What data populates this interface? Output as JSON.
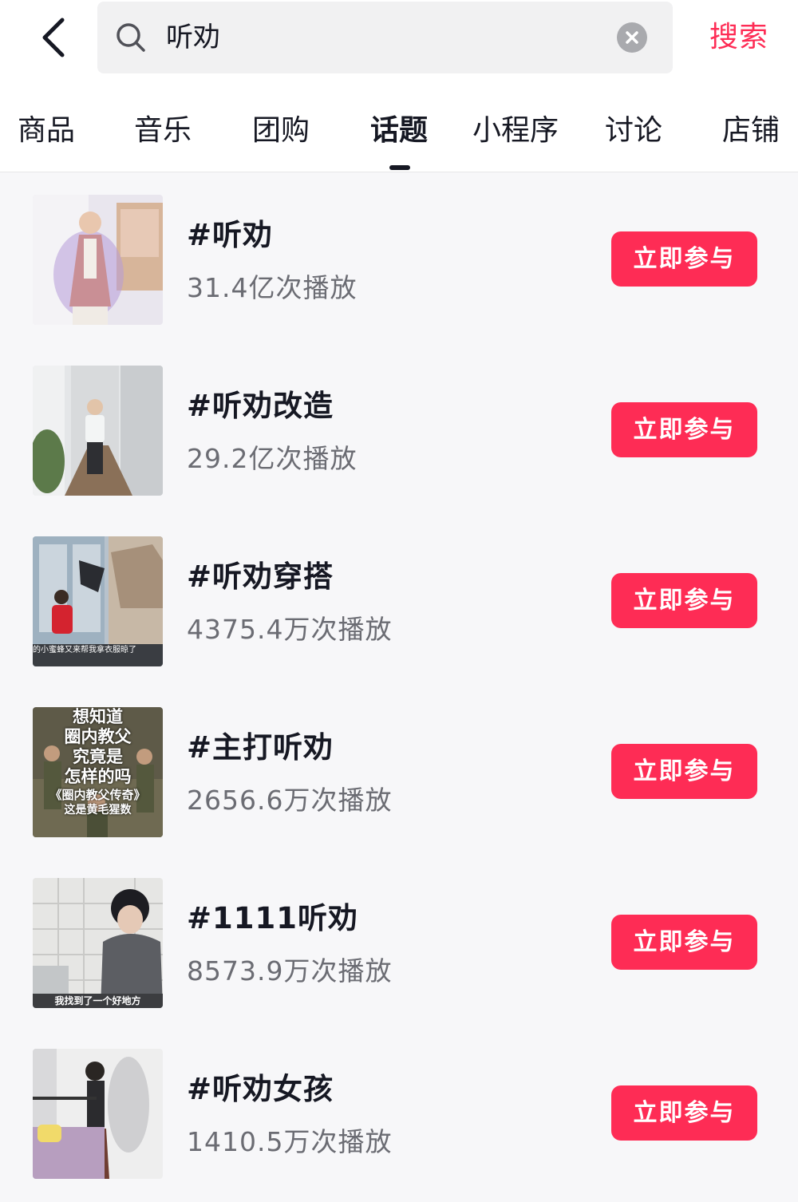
{
  "header": {
    "back_icon": "chevron-left-icon",
    "search": {
      "icon": "search-icon",
      "value": "听劝",
      "placeholder": "",
      "clear_icon": "close-circle-icon"
    },
    "search_button_label": "搜索"
  },
  "tabs": [
    {
      "label": "商品",
      "active": false
    },
    {
      "label": "音乐",
      "active": false
    },
    {
      "label": "团购",
      "active": false
    },
    {
      "label": "话题",
      "active": true
    },
    {
      "label": "小程序",
      "active": false
    },
    {
      "label": "讨论",
      "active": false
    },
    {
      "label": "店铺",
      "active": false
    }
  ],
  "topics": [
    {
      "title": "#听劝",
      "plays": "31.4亿次播放",
      "button": "立即参与",
      "thumb_caption": ""
    },
    {
      "title": "#听劝改造",
      "plays": "29.2亿次播放",
      "button": "立即参与",
      "thumb_caption": ""
    },
    {
      "title": "#听劝穿搭",
      "plays": "4375.4万次播放",
      "button": "立即参与",
      "thumb_caption": "的小蜜蜂又来帮我拿衣服晾了"
    },
    {
      "title": "#主打听劝",
      "plays": "2656.6万次播放",
      "button": "立即参与",
      "thumb_caption_lines": [
        "想知道",
        "圈内教父",
        "究竟是",
        "怎样的吗",
        "《圈内教父传奇》",
        "这是黄毛猩数"
      ]
    },
    {
      "title": "#1111听劝",
      "plays": "8573.9万次播放",
      "button": "立即参与",
      "thumb_caption": "我找到了一个好地方"
    },
    {
      "title": "#听劝女孩",
      "plays": "1410.5万次播放",
      "button": "立即参与",
      "thumb_caption": ""
    }
  ],
  "colors": {
    "accent": "#fe2c55",
    "background": "#f7f7f9",
    "text_primary": "#161823",
    "text_secondary": "#6b6c73"
  }
}
